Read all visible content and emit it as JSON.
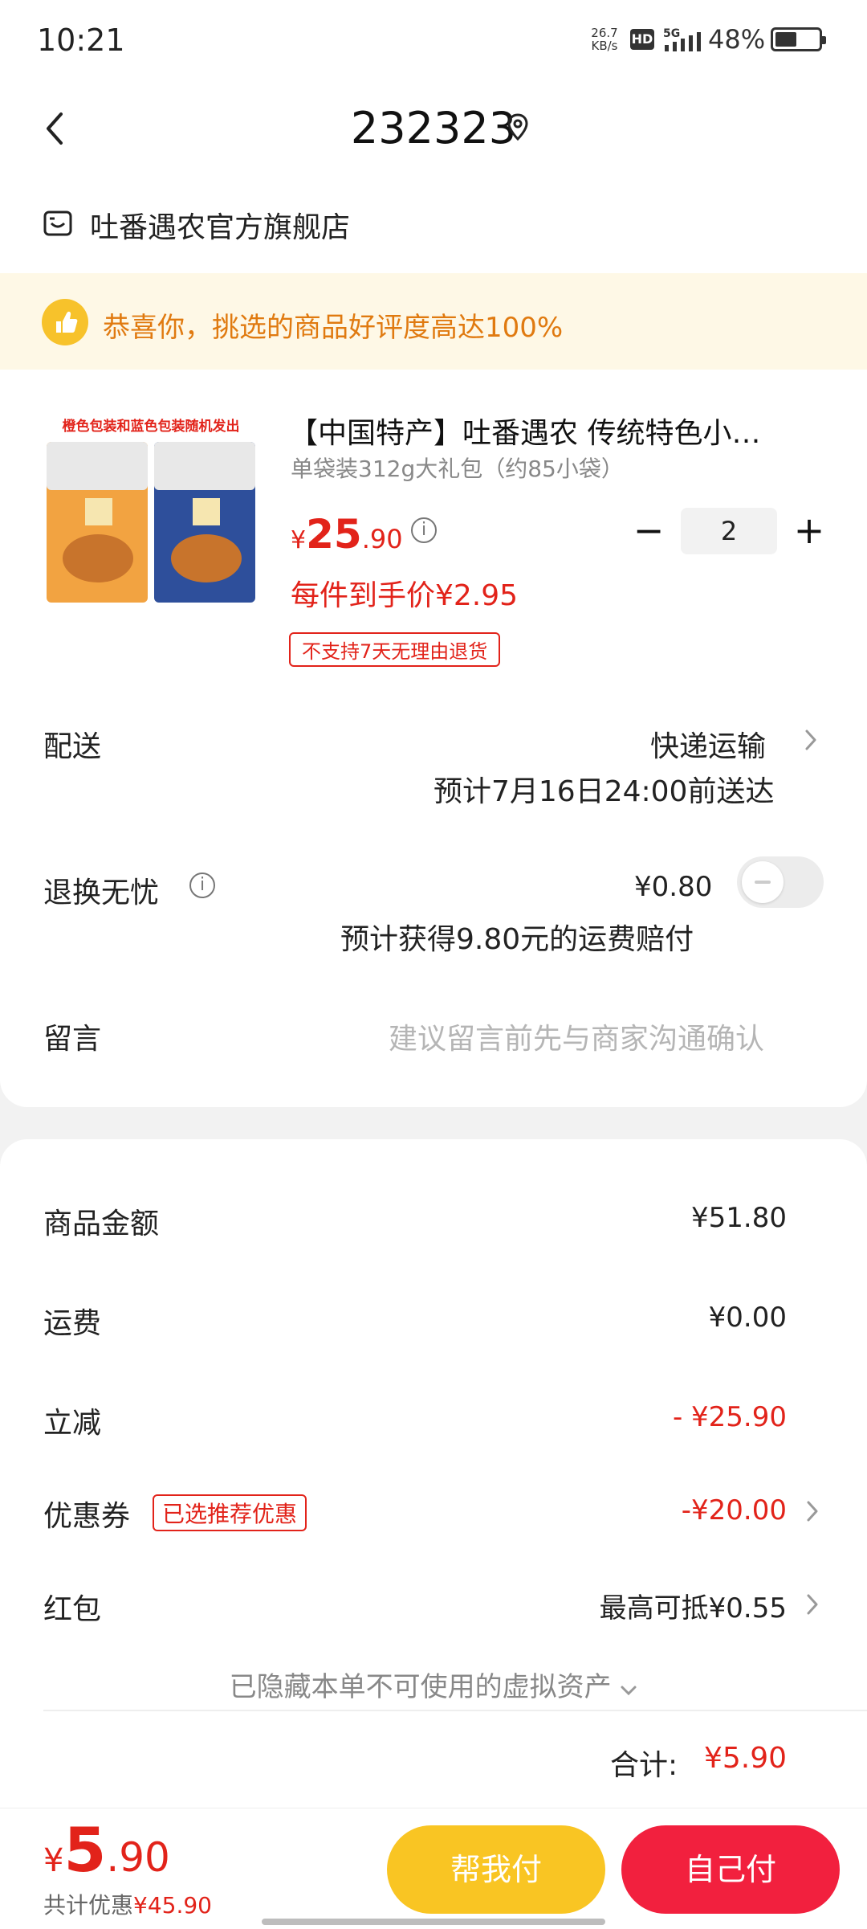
{
  "status_bar": {
    "time": "10:21",
    "net_speed_value": "26.7",
    "net_speed_unit": "KB/s",
    "hd_label": "HD",
    "network": "5G",
    "battery_percent": "48%"
  },
  "header": {
    "title": "232323"
  },
  "store": {
    "name": "吐番遇农官方旗舰店"
  },
  "banner": {
    "text": "恭喜你，挑选的商品好评度高达100%"
  },
  "product": {
    "image_caption": "橙色包装和蓝色包装随机发出",
    "title": "【中国特产】吐番遇农 传统特色小…",
    "spec": "单袋装312g大礼包（约85小袋）",
    "price_symbol": "¥",
    "price_int": "25",
    "price_dec": ".90",
    "per_item_price": "每件到手价¥2.95",
    "no_return_tag": "不支持7天无理由退货",
    "quantity": "2",
    "minus_label": "−",
    "plus_label": "+"
  },
  "shipping": {
    "label": "配送",
    "method": "快递运输",
    "eta": "预计7月16日24:00前送达"
  },
  "insurance": {
    "label": "退换无忧",
    "price": "¥0.80",
    "note": "预计获得9.80元的运费赔付",
    "enabled": false
  },
  "message": {
    "label": "留言",
    "placeholder": "建议留言前先与商家沟通确认"
  },
  "summary": {
    "goods_label": "商品金额",
    "goods_value": "¥51.80",
    "freight_label": "运费",
    "freight_value": "¥0.00",
    "discount_label": "立减",
    "discount_value": "- ¥25.90",
    "coupon_label": "优惠券",
    "coupon_tag": "已选推荐优惠",
    "coupon_value": "-¥20.00",
    "redpack_label": "红包",
    "redpack_value": "最高可抵¥0.55",
    "hidden_assets": "已隐藏本单不可使用的虚拟资产",
    "total_label": "合计:",
    "total_value": "¥5.90"
  },
  "bottom_bar": {
    "pay_symbol": "¥",
    "pay_int": "5",
    "pay_dec": ".90",
    "saved_label": "共计优惠",
    "saved_value": "¥45.90",
    "help_pay_label": "帮我付",
    "self_pay_label": "自己付"
  },
  "colors": {
    "accent_red": "#e2231a",
    "help_button": "#f9c523",
    "pay_button": "#f2203e",
    "banner_bg": "#fef8e6",
    "banner_text": "#e07a10"
  }
}
